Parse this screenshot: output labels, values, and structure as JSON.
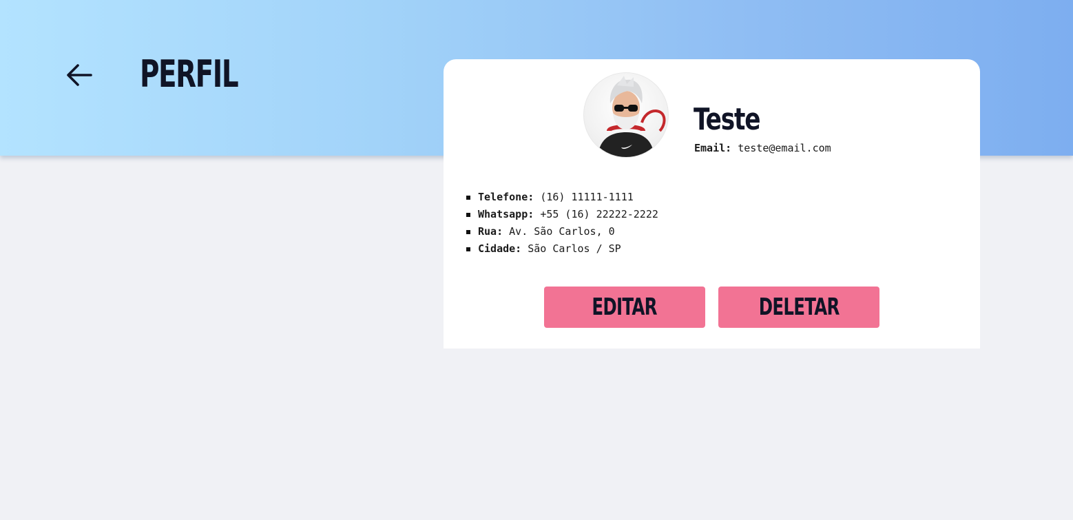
{
  "header": {
    "title": "PERFIL",
    "back_icon": "arrow-left-icon",
    "gradient_start": "#b3e3ff",
    "gradient_end": "#7daef0"
  },
  "profile": {
    "name": "Teste",
    "email_label": "Email:",
    "email_value": "teste@email.com",
    "avatar_icon": "avatar-illustration"
  },
  "details": [
    {
      "label": "Telefone:",
      "value": "(16) 11111-1111"
    },
    {
      "label": "Whatsapp:",
      "value": "+55 (16) 22222-2222"
    },
    {
      "label": "Rua:",
      "value": "Av. São Carlos, 0"
    },
    {
      "label": "Cidade:",
      "value": "São Carlos / SP"
    }
  ],
  "actions": {
    "edit_label": "EDITAR",
    "delete_label": "DELETAR",
    "button_color": "#f27394"
  },
  "colors": {
    "background": "#f0f1f5",
    "text_dark": "#101426"
  }
}
